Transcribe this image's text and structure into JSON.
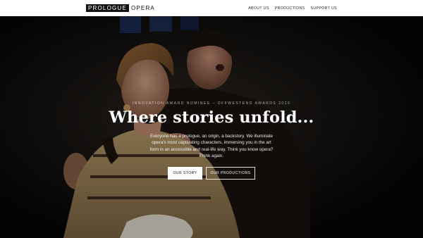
{
  "nav": {
    "logo_boxed": "PROLOGUE",
    "logo_word": "OPERA",
    "links": [
      "ABOUT US",
      "PRODUCTIONS",
      "SUPPORT US"
    ]
  },
  "hero": {
    "kicker": "INNOVATION AWARD NOMINEE – OFFWESTEND AWARDS 2020",
    "headline": "Where stories unfold...",
    "lede": "Everyone has a prologue, an origin, a backstory. We illuminate opera's most captivating characters, immersing you in the art form in an accessible and real-life way. Think you know opera? Think again.",
    "primary_button": "OUR STORY",
    "secondary_button": "OUR PRODUCTIONS"
  },
  "colors": {
    "nav_bg": "#ffffff",
    "hero_bg": "#0b0b0d",
    "text_light": "#ffffff"
  }
}
